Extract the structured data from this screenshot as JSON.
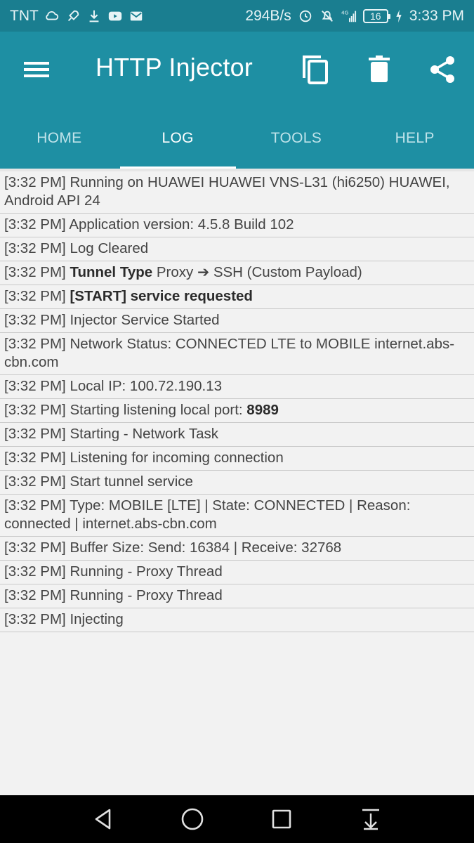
{
  "status_bar": {
    "carrier": "TNT",
    "speed": "294B/s",
    "network": "4G",
    "battery": "16",
    "time": "3:33 PM"
  },
  "appbar": {
    "title": "HTTP Injector",
    "icons": [
      "menu-icon",
      "copy-icon",
      "trash-icon",
      "share-icon"
    ]
  },
  "tabs": [
    {
      "label": "HOME"
    },
    {
      "label": "LOG"
    },
    {
      "label": "TOOLS"
    },
    {
      "label": "HELP"
    }
  ],
  "active_tab": "LOG",
  "log": [
    {
      "time": "[3:32 PM]",
      "pre": "Running on HUAWEI HUAWEI VNS-L31 (hi6250) HUAWEI, Android API 24",
      "bold": "",
      "post": ""
    },
    {
      "time": "[3:32 PM]",
      "pre": "Application version: 4.5.8 Build 102",
      "bold": "",
      "post": ""
    },
    {
      "time": "[3:32 PM]",
      "pre": "Log Cleared",
      "bold": "",
      "post": ""
    },
    {
      "time": "[3:32 PM]",
      "pre": "",
      "bold": "Tunnel Type",
      "post": "Proxy ➔ SSH (Custom Payload)"
    },
    {
      "time": "[3:32 PM]",
      "pre": "",
      "bold": "[START] service requested",
      "post": ""
    },
    {
      "time": "[3:32 PM]",
      "pre": "Injector Service Started",
      "bold": "",
      "post": ""
    },
    {
      "time": "[3:32 PM]",
      "pre": "Network Status: CONNECTED LTE to MOBILE internet.abs-cbn.com",
      "bold": "",
      "post": ""
    },
    {
      "time": "[3:32 PM]",
      "pre": "Local IP: 100.72.190.13",
      "bold": "",
      "post": ""
    },
    {
      "time": "[3:32 PM]",
      "pre": "Starting listening local port:",
      "bold": "8989",
      "post": ""
    },
    {
      "time": "[3:32 PM]",
      "pre": "Starting - Network Task",
      "bold": "",
      "post": ""
    },
    {
      "time": "[3:32 PM]",
      "pre": "Listening for incoming connection",
      "bold": "",
      "post": ""
    },
    {
      "time": "[3:32 PM]",
      "pre": "Start tunnel service",
      "bold": "",
      "post": ""
    },
    {
      "time": "[3:32 PM]",
      "pre": "Type: MOBILE [LTE] | State: CONNECTED | Reason: connected | internet.abs-cbn.com",
      "bold": "",
      "post": ""
    },
    {
      "time": "[3:32 PM]",
      "pre": "Buffer Size: Send: 16384 | Receive: 32768",
      "bold": "",
      "post": ""
    },
    {
      "time": "[3:32 PM]",
      "pre": "Running - Proxy Thread",
      "bold": "",
      "post": ""
    },
    {
      "time": "[3:32 PM]",
      "pre": "Running - Proxy Thread",
      "bold": "",
      "post": ""
    },
    {
      "time": "[3:32 PM]",
      "pre": "Injecting",
      "bold": "",
      "post": ""
    }
  ],
  "navbar": {
    "icons": [
      "back-icon",
      "home-icon",
      "recents-icon",
      "notification-pull-icon"
    ]
  },
  "colors": {
    "status_bar": "#1a7e90",
    "toolbar": "#1e8fa3",
    "log_background": "#f2f2f2"
  }
}
